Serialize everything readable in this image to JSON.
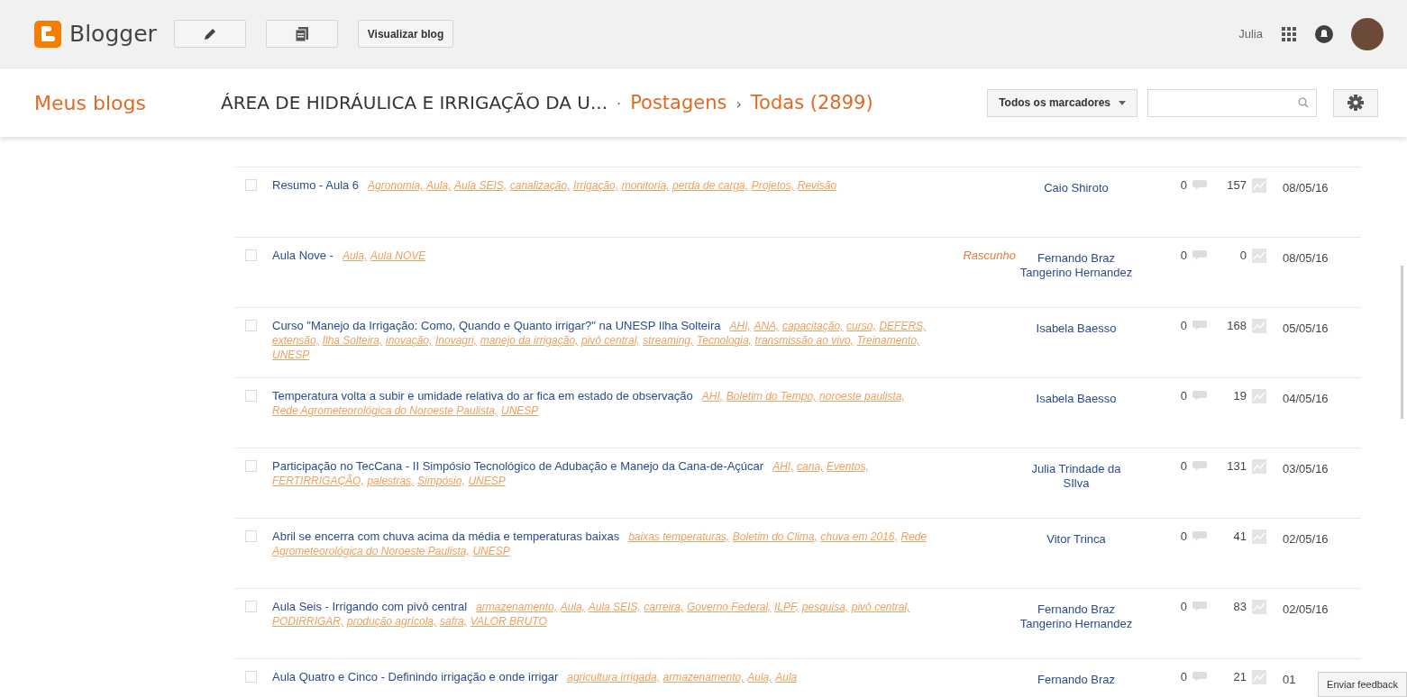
{
  "header": {
    "app_name": "Blogger",
    "view_button": "Visualizar blog",
    "user_name": "Julia"
  },
  "nav": {
    "my_blogs": "Meus blogs",
    "blog_title": "ÁREA DE HIDRÁULICA E IRRIGAÇÃO DA U...",
    "separator": "·",
    "section": "Postagens",
    "chevron": "›",
    "filter": "Todas (2899)",
    "labels_dropdown": "Todos os marcadores"
  },
  "posts": [
    {
      "selected": false,
      "title": "Resumo - Aula 6",
      "labels": [
        "Agronomia,",
        "Aula,",
        "Aula SEIS,",
        "canalização,",
        "Irrigação,",
        "monitoria,",
        "perda de carga,",
        "Projetos,",
        "Revisão"
      ],
      "author": "Caio Shiroto",
      "comments": "0",
      "views": "157",
      "date": "08/05/16"
    },
    {
      "selected": false,
      "title": "Aula Nove -",
      "labels": [
        "Aula,",
        "Aula NOVE"
      ],
      "status": "Rascunho",
      "author": "Fernando Braz Tangerino Hernandez",
      "comments": "0",
      "views": "0",
      "date": "08/05/16"
    },
    {
      "selected": false,
      "title": "Curso \"Manejo da Irrigação: Como, Quando e Quanto irrigar?\" na UNESP Ilha Solteira",
      "labels": [
        "AHI,",
        "ANA,",
        "capacitação,",
        "curso,",
        "DEFERS,",
        "extensão,",
        "Ilha Solteira,",
        "inovação,",
        "Inovagri,",
        "manejo da irrigação,",
        "pivô central,",
        "streaming,",
        "Tecnologia,",
        "transmissão ao vivo,",
        "Treinamento,",
        "UNESP"
      ],
      "author": "Isabela Baesso",
      "comments": "0",
      "views": "168",
      "date": "05/05/16"
    },
    {
      "selected": false,
      "title": "Temperatura volta a subir e umidade relativa do ar fica em estado de observação",
      "labels": [
        "AHI,",
        "Boletim do Tempo,",
        "noroeste paulista,",
        "Rede Agrometeorológica do Noroeste Paulista,",
        "UNESP"
      ],
      "author": "Isabela Baesso",
      "comments": "0",
      "views": "19",
      "date": "04/05/16"
    },
    {
      "selected": false,
      "title": "Participação no TecCana - II Simpósio Tecnológico de Adubação e Manejo da Cana-de-Açúcar",
      "labels": [
        "AHI,",
        "cana,",
        "Eventos,",
        "FERTIRRIGAÇÃO,",
        "palestras,",
        "Simpósio,",
        "UNESP"
      ],
      "author": "Julia Trindade da SIlva",
      "comments": "0",
      "views": "131",
      "date": "03/05/16"
    },
    {
      "selected": false,
      "title": "Abril se encerra com chuva acima da média e temperaturas baixas",
      "labels": [
        "baixas temperaturas,",
        "Boletim do Clima,",
        "chuva em 2016,",
        "Rede Agrometeorológica do Noroeste Paulista,",
        "UNESP"
      ],
      "author": "Vitor Trinca",
      "comments": "0",
      "views": "41",
      "date": "02/05/16"
    },
    {
      "selected": false,
      "title": "Aula Seis - Irrigando com pivô central",
      "labels": [
        "armazenamento,",
        "Aula,",
        "Aula SEIS,",
        "carreira,",
        "Governo Federal,",
        "ILPF,",
        "pesquisa,",
        "pivô central,",
        "PODIRRIGAR,",
        "produção agrícola,",
        "safra,",
        "VALOR BRUTO"
      ],
      "author": "Fernando Braz Tangerino Hernandez",
      "comments": "0",
      "views": "83",
      "date": "02/05/16"
    },
    {
      "selected": false,
      "title": "Aula Quatro e Cinco - Definindo irrigação e onde irrigar",
      "labels": [
        "agricultura irrigada,",
        "armazenamento,",
        "Aula,",
        "Aula"
      ],
      "author": "Fernando Braz",
      "comments": "0",
      "views": "21",
      "date": "01"
    }
  ],
  "feedback_button": "Enviar feedback"
}
